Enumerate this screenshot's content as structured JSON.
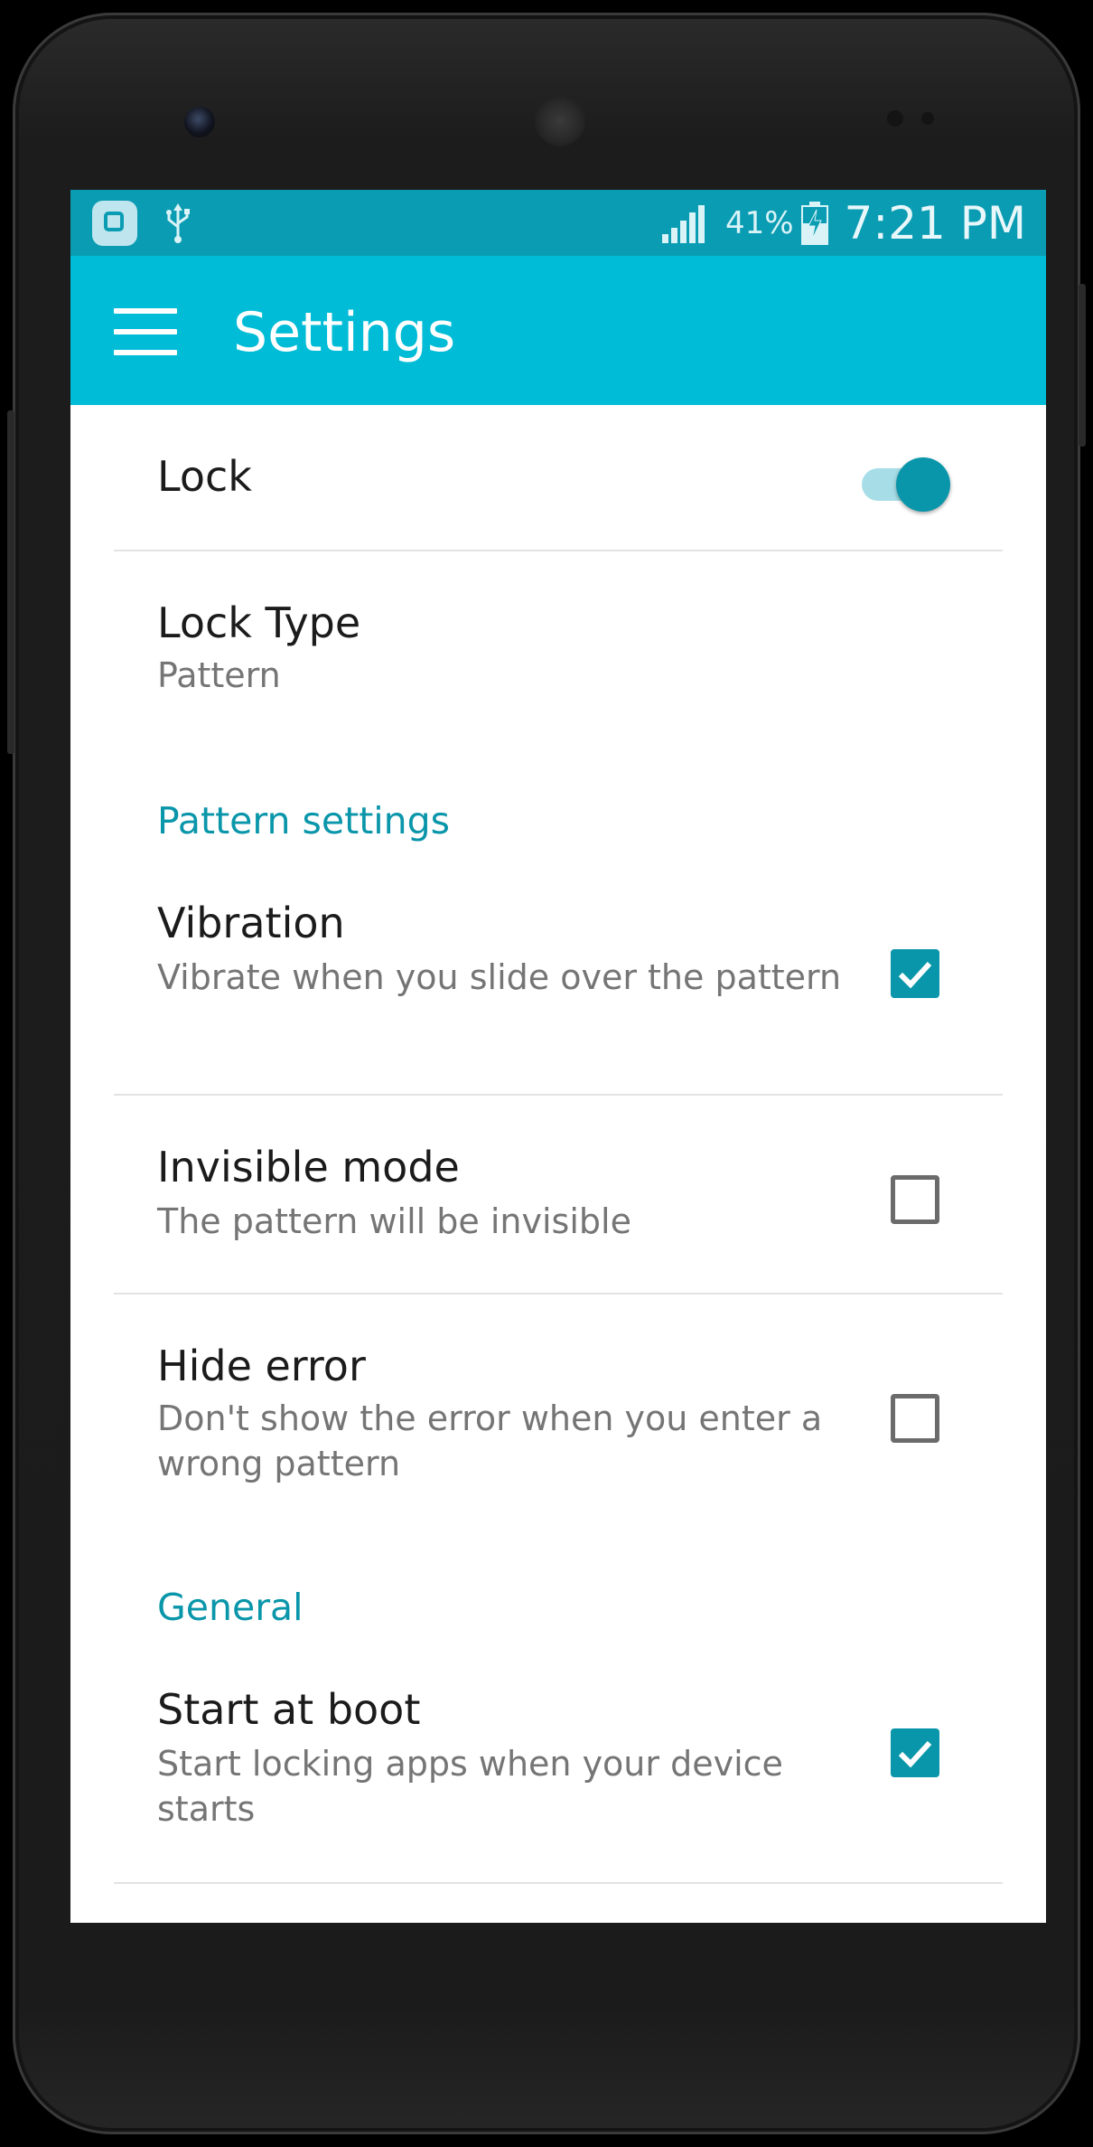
{
  "status_bar": {
    "battery_percent": "41%",
    "time": "7:21 PM",
    "icons": [
      "app-notification-icon",
      "usb-icon",
      "signal-icon",
      "battery-charging-icon"
    ]
  },
  "app_bar": {
    "title": "Settings",
    "menu_icon": "hamburger-menu-icon"
  },
  "preferences": {
    "lock": {
      "title": "Lock",
      "switch_on": true
    },
    "lock_type": {
      "title": "Lock Type",
      "summary": "Pattern"
    },
    "pattern_category": "Pattern settings",
    "vibration": {
      "title": "Vibration",
      "summary": "Vibrate when you slide over the pattern",
      "checked": true
    },
    "invisible_mode": {
      "title": "Invisible mode",
      "summary": "The pattern will be invisible",
      "checked": false
    },
    "hide_error": {
      "title": "Hide error",
      "summary": "Don't show the error when you enter a wrong pattern",
      "checked": false
    },
    "general_category": "General",
    "start_at_boot": {
      "title": "Start at boot",
      "summary": "Start locking apps when your device starts",
      "checked": true
    }
  },
  "colors": {
    "status_bar": "#0a9cb3",
    "app_bar": "#00bcd6",
    "accent": "#0a96aa",
    "switch_track": "#a6dde6"
  }
}
